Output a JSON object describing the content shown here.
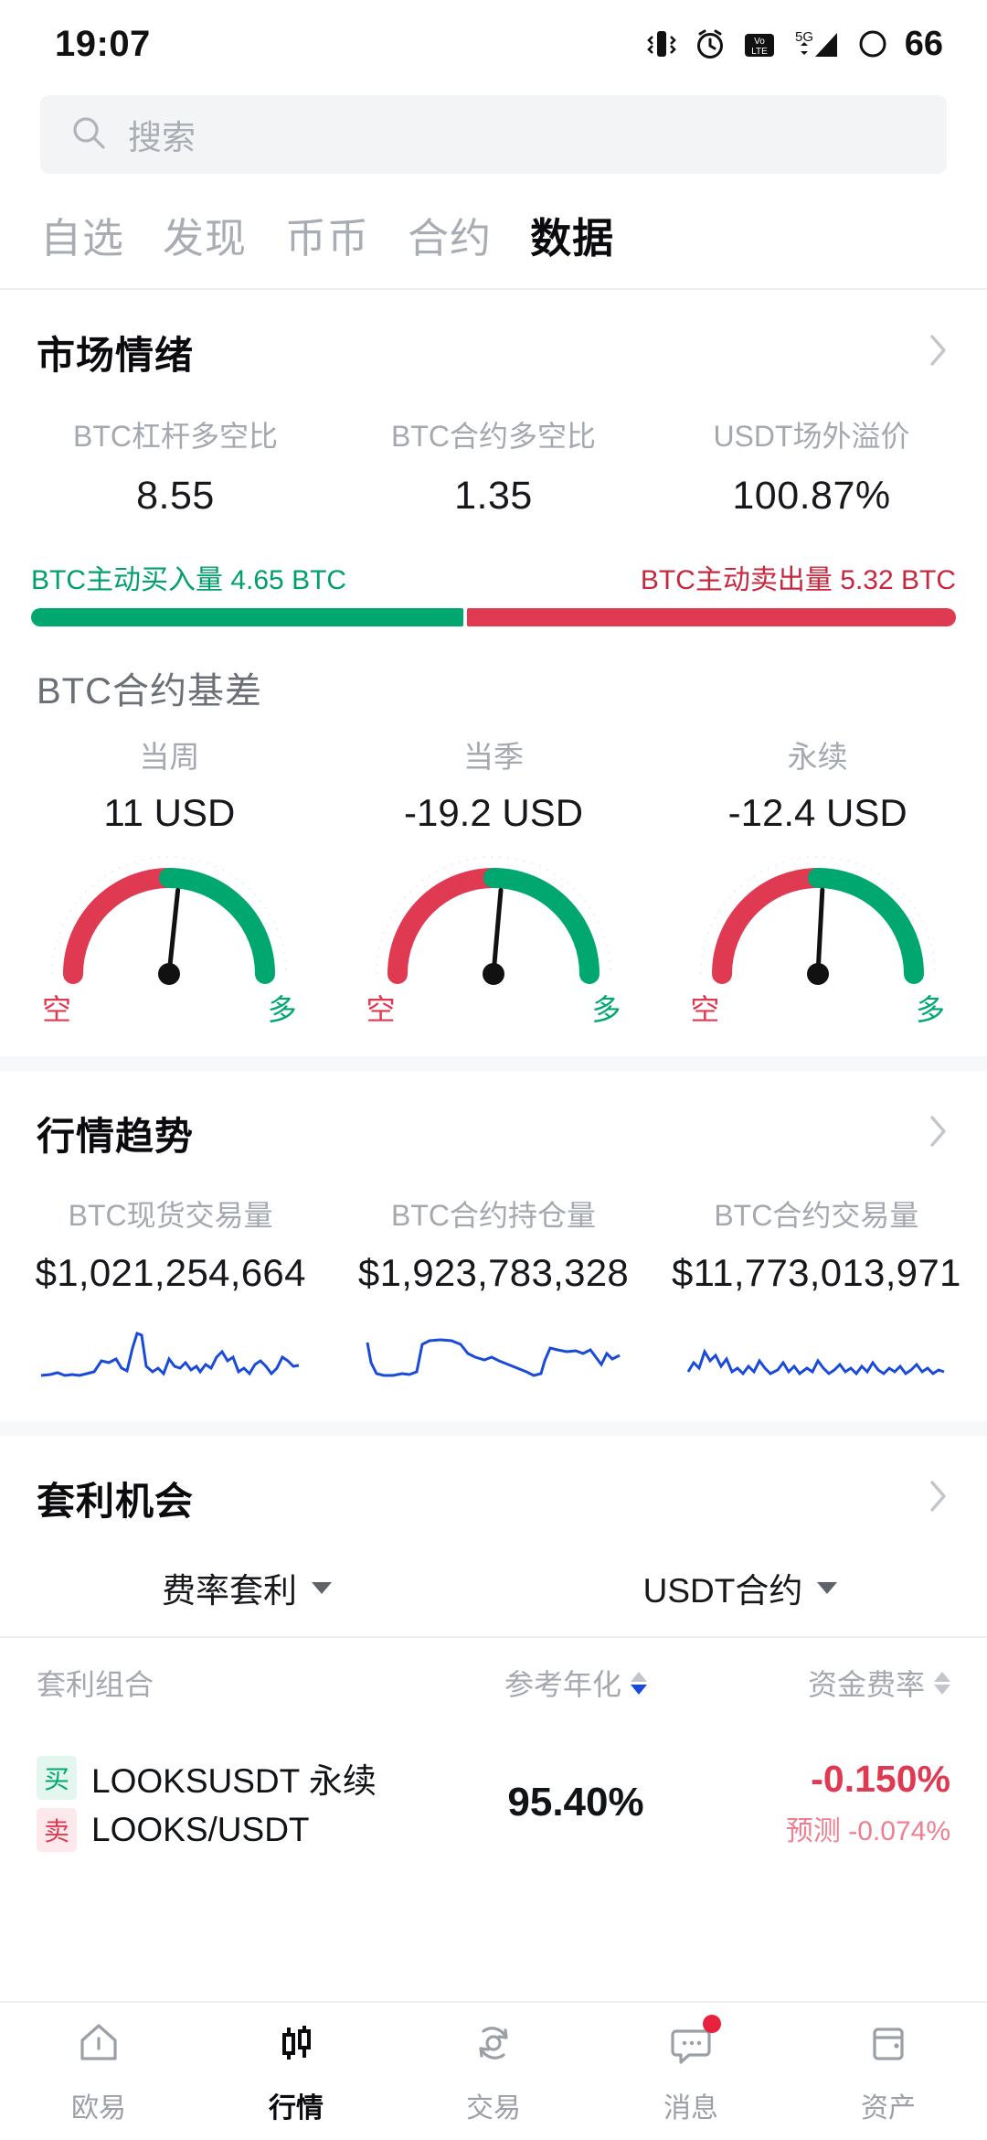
{
  "status_bar": {
    "time": "19:07",
    "battery_level": "66",
    "icons": [
      "vibrate-icon",
      "alarm-icon",
      "volte-icon",
      "5g-signal-icon",
      "battery-icon"
    ],
    "network_label": "5G",
    "volte_label": "VoLTE"
  },
  "search": {
    "placeholder": "搜索",
    "value": ""
  },
  "tabs": [
    {
      "label": "自选",
      "active": false
    },
    {
      "label": "发现",
      "active": false
    },
    {
      "label": "币币",
      "active": false
    },
    {
      "label": "合约",
      "active": false
    },
    {
      "label": "数据",
      "active": true
    }
  ],
  "market_sentiment": {
    "title": "市场情绪",
    "metrics": [
      {
        "label": "BTC杠杆多空比",
        "value": "8.55"
      },
      {
        "label": "BTC合约多空比",
        "value": "1.35"
      },
      {
        "label": "USDT场外溢价",
        "value": "100.87%"
      }
    ],
    "flow": {
      "buy_label": "BTC主动买入量",
      "buy_value": "4.65 BTC",
      "sell_label": "BTC主动卖出量",
      "sell_value": "5.32 BTC",
      "buy_percent": 46.7,
      "sell_percent": 53.3,
      "buy_color": "#00a870",
      "sell_color": "#e03a52"
    }
  },
  "basis": {
    "title": "BTC合约基差",
    "short_label": "空",
    "long_label": "多",
    "items": [
      {
        "label": "当周",
        "value": "11 USD",
        "needle_angle": 6
      },
      {
        "label": "当季",
        "value": "-19.2 USD",
        "needle_angle": 5
      },
      {
        "label": "永续",
        "value": "-12.4 USD",
        "needle_angle": 3
      }
    ]
  },
  "trend": {
    "title": "行情趋势",
    "items": [
      {
        "label": "BTC现货交易量",
        "value": "$1,021,254,664"
      },
      {
        "label": "BTC合约持仓量",
        "value": "$1,923,783,328"
      },
      {
        "label": "BTC合约交易量",
        "value": "$11,773,013,971"
      }
    ],
    "line_color": "#1a4bd8"
  },
  "arbitrage": {
    "title": "套利机会",
    "filters": [
      {
        "label": "费率套利"
      },
      {
        "label": "USDT合约"
      }
    ],
    "columns": [
      {
        "label": "套利组合",
        "sort": "none"
      },
      {
        "label": "参考年化",
        "sort": "desc"
      },
      {
        "label": "资金费率",
        "sort": "none"
      }
    ],
    "rows": [
      {
        "buy_tag": "买",
        "buy_text": "LOOKSUSDT  永续",
        "sell_tag": "卖",
        "sell_text": "LOOKS/USDT",
        "apr": "95.40%",
        "rate": "-0.150%",
        "rate_forecast": "预测 -0.074%"
      }
    ]
  },
  "bottom_nav": [
    {
      "label": "欧易",
      "icon": "home-icon",
      "active": false,
      "badge": false
    },
    {
      "label": "行情",
      "icon": "candlestick-icon",
      "active": true,
      "badge": false
    },
    {
      "label": "交易",
      "icon": "swap-icon",
      "active": false,
      "badge": false
    },
    {
      "label": "消息",
      "icon": "chat-icon",
      "active": false,
      "badge": true
    },
    {
      "label": "资产",
      "icon": "wallet-icon",
      "active": false,
      "badge": false
    }
  ]
}
